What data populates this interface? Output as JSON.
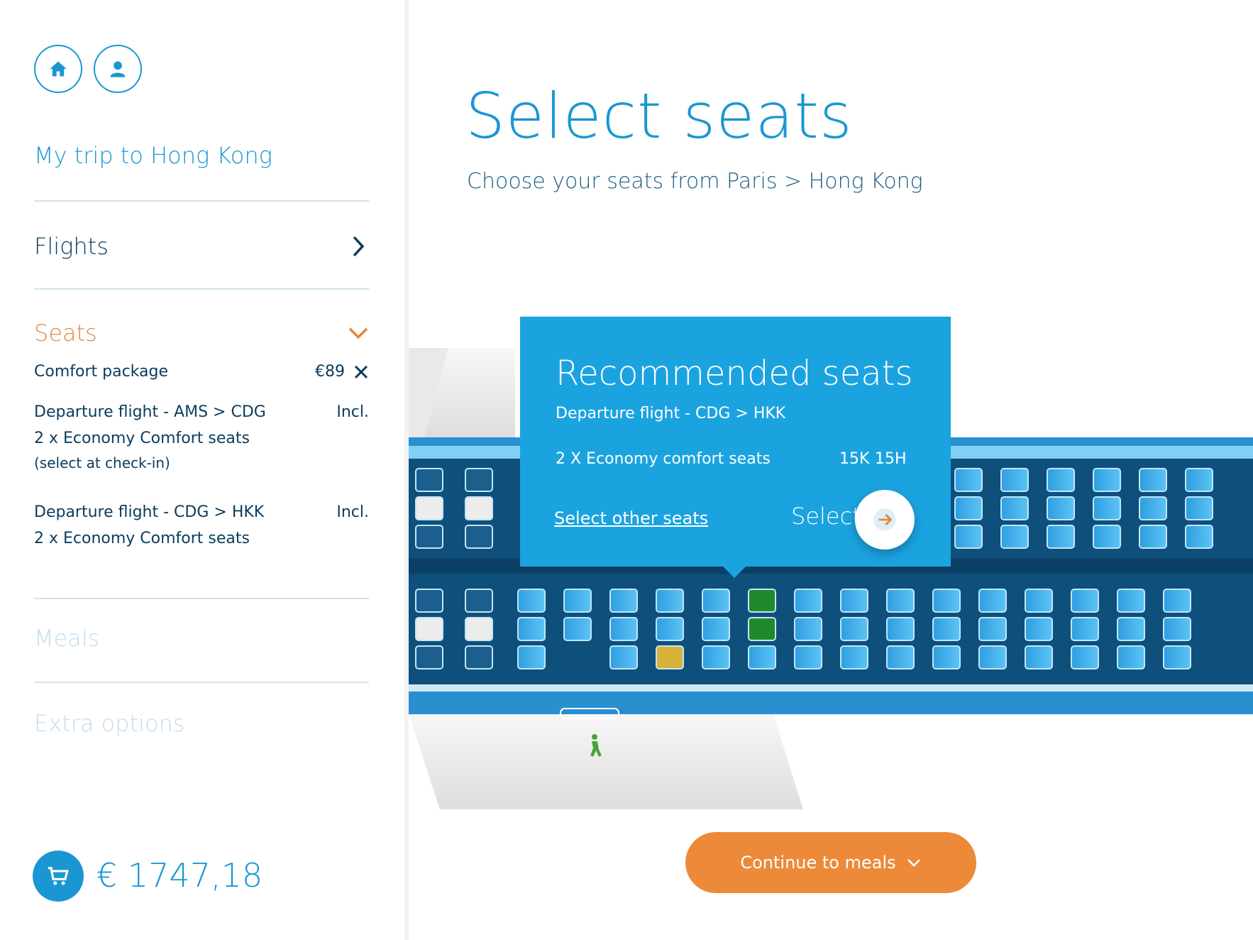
{
  "colors": {
    "brand_blue": "#1a97d2",
    "popup_blue": "#1ba3e0",
    "accent_orange": "#e4873f",
    "button_orange": "#ec8a3a",
    "seat_recommended": "#1f8a2c",
    "seat_selected": "#d8b33a"
  },
  "sidebar": {
    "home_icon": "home-icon",
    "profile_icon": "user-icon",
    "trip_title": "My trip to Hong Kong",
    "flights_label": "Flights",
    "seats_label": "Seats",
    "comfort_package": {
      "label": "Comfort package",
      "price": "€89"
    },
    "items": [
      {
        "title": "Departure flight - AMS > CDG",
        "price": "Incl.",
        "line2": "2 x Economy Comfort seats",
        "line3": "(select at check-in)"
      },
      {
        "title": "Departure flight - CDG > HKK",
        "price": "Incl.",
        "line2": "2 x Economy Comfort seats"
      }
    ],
    "meals_label": "Meals",
    "extra_label": "Extra options",
    "total": "€ 1747,18"
  },
  "main": {
    "title": "Select seats",
    "subtitle": "Choose your seats from Paris > Hong Kong"
  },
  "popup": {
    "title": "Recommended seats",
    "flight": "Departure flight - CDG > HKK",
    "seats_label": "2 X Economy comfort seats",
    "seat_a": "15K",
    "seat_b": "15H",
    "select_other": "Select other seats",
    "select": "Select"
  },
  "continue_button": "Continue to meals"
}
